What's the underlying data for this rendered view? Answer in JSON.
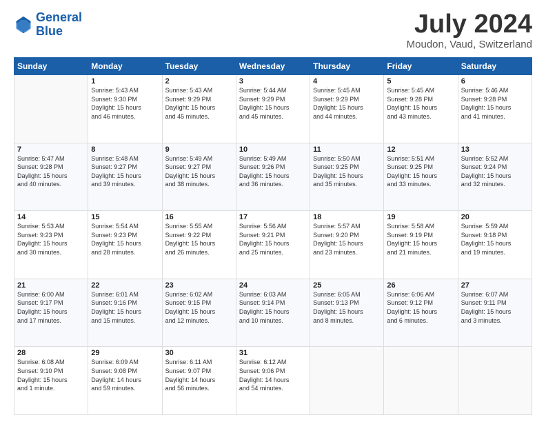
{
  "header": {
    "logo_line1": "General",
    "logo_line2": "Blue",
    "month": "July 2024",
    "location": "Moudon, Vaud, Switzerland"
  },
  "weekdays": [
    "Sunday",
    "Monday",
    "Tuesday",
    "Wednesday",
    "Thursday",
    "Friday",
    "Saturday"
  ],
  "weeks": [
    [
      {
        "day": "",
        "text": ""
      },
      {
        "day": "1",
        "text": "Sunrise: 5:43 AM\nSunset: 9:30 PM\nDaylight: 15 hours\nand 46 minutes."
      },
      {
        "day": "2",
        "text": "Sunrise: 5:43 AM\nSunset: 9:29 PM\nDaylight: 15 hours\nand 45 minutes."
      },
      {
        "day": "3",
        "text": "Sunrise: 5:44 AM\nSunset: 9:29 PM\nDaylight: 15 hours\nand 45 minutes."
      },
      {
        "day": "4",
        "text": "Sunrise: 5:45 AM\nSunset: 9:29 PM\nDaylight: 15 hours\nand 44 minutes."
      },
      {
        "day": "5",
        "text": "Sunrise: 5:45 AM\nSunset: 9:28 PM\nDaylight: 15 hours\nand 43 minutes."
      },
      {
        "day": "6",
        "text": "Sunrise: 5:46 AM\nSunset: 9:28 PM\nDaylight: 15 hours\nand 41 minutes."
      }
    ],
    [
      {
        "day": "7",
        "text": "Sunrise: 5:47 AM\nSunset: 9:28 PM\nDaylight: 15 hours\nand 40 minutes."
      },
      {
        "day": "8",
        "text": "Sunrise: 5:48 AM\nSunset: 9:27 PM\nDaylight: 15 hours\nand 39 minutes."
      },
      {
        "day": "9",
        "text": "Sunrise: 5:49 AM\nSunset: 9:27 PM\nDaylight: 15 hours\nand 38 minutes."
      },
      {
        "day": "10",
        "text": "Sunrise: 5:49 AM\nSunset: 9:26 PM\nDaylight: 15 hours\nand 36 minutes."
      },
      {
        "day": "11",
        "text": "Sunrise: 5:50 AM\nSunset: 9:25 PM\nDaylight: 15 hours\nand 35 minutes."
      },
      {
        "day": "12",
        "text": "Sunrise: 5:51 AM\nSunset: 9:25 PM\nDaylight: 15 hours\nand 33 minutes."
      },
      {
        "day": "13",
        "text": "Sunrise: 5:52 AM\nSunset: 9:24 PM\nDaylight: 15 hours\nand 32 minutes."
      }
    ],
    [
      {
        "day": "14",
        "text": "Sunrise: 5:53 AM\nSunset: 9:23 PM\nDaylight: 15 hours\nand 30 minutes."
      },
      {
        "day": "15",
        "text": "Sunrise: 5:54 AM\nSunset: 9:23 PM\nDaylight: 15 hours\nand 28 minutes."
      },
      {
        "day": "16",
        "text": "Sunrise: 5:55 AM\nSunset: 9:22 PM\nDaylight: 15 hours\nand 26 minutes."
      },
      {
        "day": "17",
        "text": "Sunrise: 5:56 AM\nSunset: 9:21 PM\nDaylight: 15 hours\nand 25 minutes."
      },
      {
        "day": "18",
        "text": "Sunrise: 5:57 AM\nSunset: 9:20 PM\nDaylight: 15 hours\nand 23 minutes."
      },
      {
        "day": "19",
        "text": "Sunrise: 5:58 AM\nSunset: 9:19 PM\nDaylight: 15 hours\nand 21 minutes."
      },
      {
        "day": "20",
        "text": "Sunrise: 5:59 AM\nSunset: 9:18 PM\nDaylight: 15 hours\nand 19 minutes."
      }
    ],
    [
      {
        "day": "21",
        "text": "Sunrise: 6:00 AM\nSunset: 9:17 PM\nDaylight: 15 hours\nand 17 minutes."
      },
      {
        "day": "22",
        "text": "Sunrise: 6:01 AM\nSunset: 9:16 PM\nDaylight: 15 hours\nand 15 minutes."
      },
      {
        "day": "23",
        "text": "Sunrise: 6:02 AM\nSunset: 9:15 PM\nDaylight: 15 hours\nand 12 minutes."
      },
      {
        "day": "24",
        "text": "Sunrise: 6:03 AM\nSunset: 9:14 PM\nDaylight: 15 hours\nand 10 minutes."
      },
      {
        "day": "25",
        "text": "Sunrise: 6:05 AM\nSunset: 9:13 PM\nDaylight: 15 hours\nand 8 minutes."
      },
      {
        "day": "26",
        "text": "Sunrise: 6:06 AM\nSunset: 9:12 PM\nDaylight: 15 hours\nand 6 minutes."
      },
      {
        "day": "27",
        "text": "Sunrise: 6:07 AM\nSunset: 9:11 PM\nDaylight: 15 hours\nand 3 minutes."
      }
    ],
    [
      {
        "day": "28",
        "text": "Sunrise: 6:08 AM\nSunset: 9:10 PM\nDaylight: 15 hours\nand 1 minute."
      },
      {
        "day": "29",
        "text": "Sunrise: 6:09 AM\nSunset: 9:08 PM\nDaylight: 14 hours\nand 59 minutes."
      },
      {
        "day": "30",
        "text": "Sunrise: 6:11 AM\nSunset: 9:07 PM\nDaylight: 14 hours\nand 56 minutes."
      },
      {
        "day": "31",
        "text": "Sunrise: 6:12 AM\nSunset: 9:06 PM\nDaylight: 14 hours\nand 54 minutes."
      },
      {
        "day": "",
        "text": ""
      },
      {
        "day": "",
        "text": ""
      },
      {
        "day": "",
        "text": ""
      }
    ]
  ]
}
